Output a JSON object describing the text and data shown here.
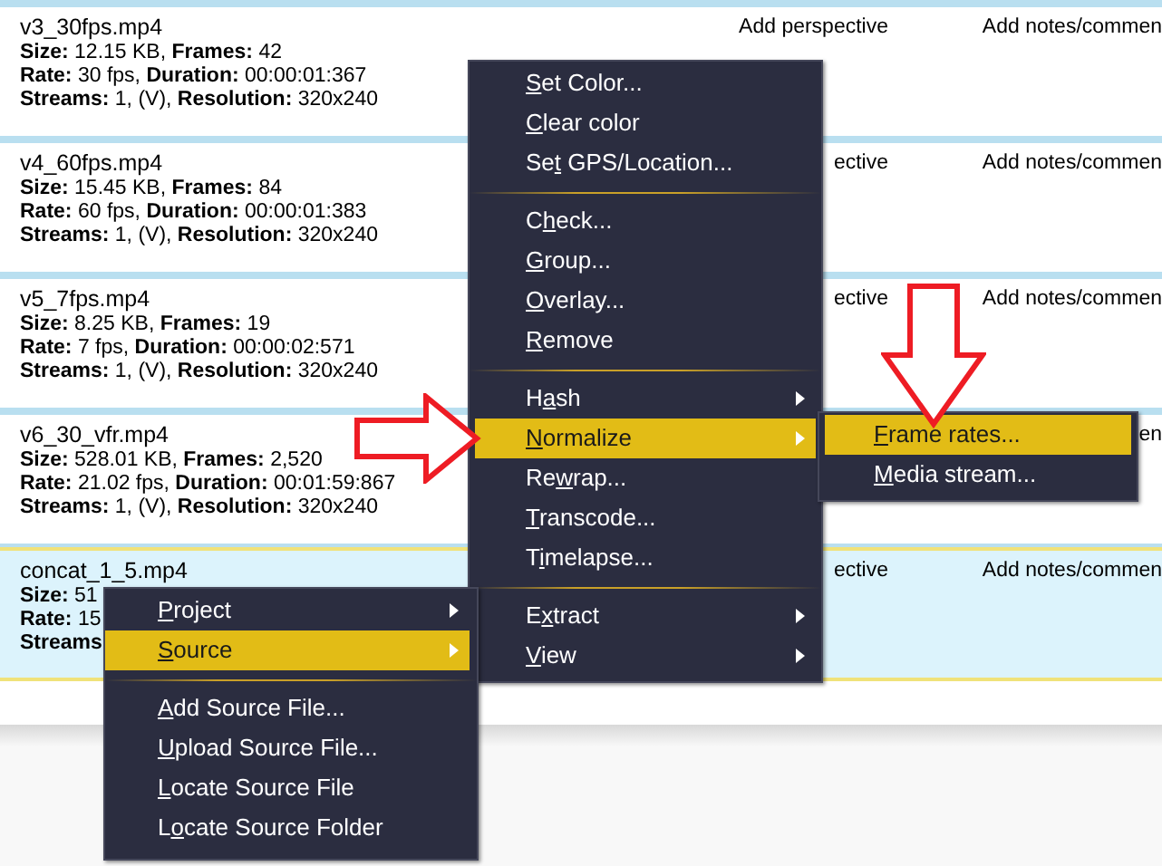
{
  "files": [
    {
      "name": "v3_30fps.mp4",
      "details": [
        "**Size:** 12.15 KB, **Frames:** 42",
        "**Rate:** 30 fps, **Duration:** 00:00:01:367",
        "**Streams:** 1, (V), **Resolution:** 320x240"
      ],
      "perspective": "Add perspective",
      "notes": "Add notes/commen",
      "selected": false
    },
    {
      "name": "v4_60fps.mp4",
      "details": [
        "**Size:** 15.45 KB, **Frames:** 84",
        "**Rate:** 60 fps, **Duration:** 00:00:01:383",
        "**Streams:** 1, (V), **Resolution:** 320x240"
      ],
      "perspective": "ective",
      "notes": "Add notes/commen",
      "selected": false
    },
    {
      "name": "v5_7fps.mp4",
      "details": [
        "**Size:** 8.25 KB, **Frames:** 19",
        "**Rate:** 7 fps, **Duration:** 00:00:02:571",
        "**Streams:** 1, (V), **Resolution:** 320x240"
      ],
      "perspective": "ective",
      "notes": "Add notes/commen",
      "selected": false
    },
    {
      "name": "v6_30_vfr.mp4",
      "details": [
        "**Size:** 528.01 KB, **Frames:** 2,520",
        "**Rate:** 21.02 fps, **Duration:** 00:01:59:867",
        "**Streams:** 1, (V), **Resolution:** 320x240"
      ],
      "notes": "en",
      "selected": false
    },
    {
      "name": "concat_1_5.mp4",
      "details": [
        "**Size:** 51",
        "**Rate:** 15",
        "**Streams**"
      ],
      "perspective": "ective",
      "notes": "Add notes/commen",
      "selected": true
    }
  ],
  "context_menu": {
    "items": [
      {
        "kind": "item",
        "key": "S",
        "post": "et Color...",
        "submenu": false,
        "selected": false
      },
      {
        "kind": "item",
        "key": "C",
        "post": "lear color",
        "submenu": false,
        "selected": false
      },
      {
        "kind": "item",
        "pre": "Se",
        "key": "t",
        "post": " GPS/Location...",
        "submenu": false,
        "selected": false
      },
      {
        "kind": "separator"
      },
      {
        "kind": "item",
        "pre": "C",
        "key": "h",
        "post": "eck...",
        "submenu": false,
        "selected": false
      },
      {
        "kind": "item",
        "key": "G",
        "post": "roup...",
        "submenu": false,
        "selected": false
      },
      {
        "kind": "item",
        "key": "O",
        "post": "verlay...",
        "submenu": false,
        "selected": false
      },
      {
        "kind": "item",
        "key": "R",
        "post": "emove",
        "submenu": false,
        "selected": false
      },
      {
        "kind": "separator"
      },
      {
        "kind": "item",
        "pre": "H",
        "key": "a",
        "post": "sh",
        "submenu": true,
        "selected": false
      },
      {
        "kind": "item",
        "key": "N",
        "post": "ormalize",
        "submenu": true,
        "selected": true
      },
      {
        "kind": "item",
        "pre": "Re",
        "key": "w",
        "post": "rap...",
        "submenu": false,
        "selected": false
      },
      {
        "kind": "item",
        "key": "T",
        "post": "ranscode...",
        "submenu": false,
        "selected": false
      },
      {
        "kind": "item",
        "pre": "T",
        "key": "i",
        "post": "melapse...",
        "submenu": false,
        "selected": false
      },
      {
        "kind": "separator"
      },
      {
        "kind": "item",
        "pre": "E",
        "key": "x",
        "post": "tract",
        "submenu": true,
        "selected": false
      },
      {
        "kind": "item",
        "key": "V",
        "post": "iew",
        "submenu": true,
        "selected": false
      }
    ]
  },
  "normalize_submenu": {
    "items": [
      {
        "kind": "item",
        "key": "F",
        "post": "rame rates...",
        "submenu": false,
        "selected": true
      },
      {
        "kind": "item",
        "key": "M",
        "post": "edia stream...",
        "submenu": false,
        "selected": false
      }
    ]
  },
  "source_menu": {
    "items": [
      {
        "kind": "item",
        "key": "P",
        "post": "roject",
        "submenu": true,
        "selected": false
      },
      {
        "kind": "item",
        "key": "S",
        "post": "ource",
        "submenu": true,
        "selected": true
      },
      {
        "kind": "separator"
      },
      {
        "kind": "item",
        "key": "A",
        "post": "dd Source File...",
        "submenu": false,
        "selected": false
      },
      {
        "kind": "item",
        "key": "U",
        "post": "pload Source File...",
        "submenu": false,
        "selected": false
      },
      {
        "kind": "item",
        "key": "L",
        "post": "ocate Source File",
        "submenu": false,
        "selected": false
      },
      {
        "kind": "item",
        "pre": "L",
        "key": "o",
        "post": "cate Source Folder",
        "submenu": false,
        "selected": false
      }
    ]
  }
}
